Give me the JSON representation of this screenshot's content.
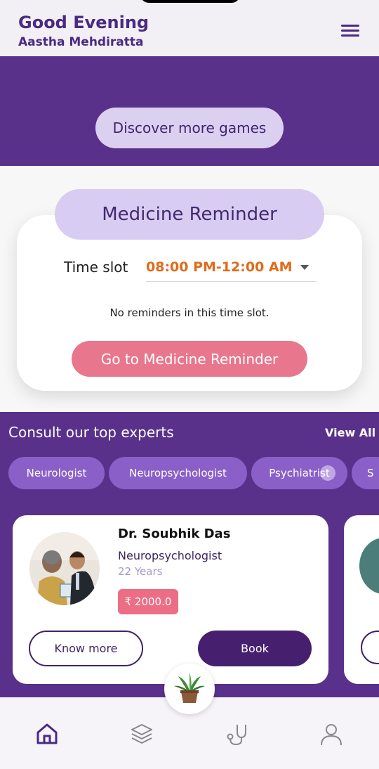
{
  "header": {
    "greeting": "Good Evening",
    "user_name": "Aastha Mehdiratta"
  },
  "games": {
    "button_label": "Discover more games"
  },
  "medicine_reminder": {
    "title": "Medicine Reminder",
    "time_slot_label": "Time slot",
    "time_slot_value": "08:00 PM-12:00 AM",
    "empty_text": "No reminders in this time slot.",
    "go_button_label": "Go to Medicine Reminder"
  },
  "experts": {
    "title": "Consult our top experts",
    "view_all_label": "View All",
    "categories": [
      "Neurologist",
      "Neuropsychologist",
      "Psychiatrist",
      "S"
    ],
    "doctors": [
      {
        "name": "Dr. Soubhik Das",
        "specialty": "Neuropsychologist",
        "experience": "22 Years",
        "fee": "₹ 2000.0",
        "know_more_label": "Know more",
        "book_label": "Book"
      }
    ]
  },
  "bottom_nav": {
    "items": [
      "home-icon",
      "layers-icon",
      "stethoscope-icon",
      "profile-icon"
    ],
    "center_icon": "plant-icon"
  },
  "colors": {
    "primary_purple": "#5a318a",
    "accent_orange": "#e06a18",
    "accent_pink": "#e8768d",
    "lavender": "#dcd0f0"
  }
}
